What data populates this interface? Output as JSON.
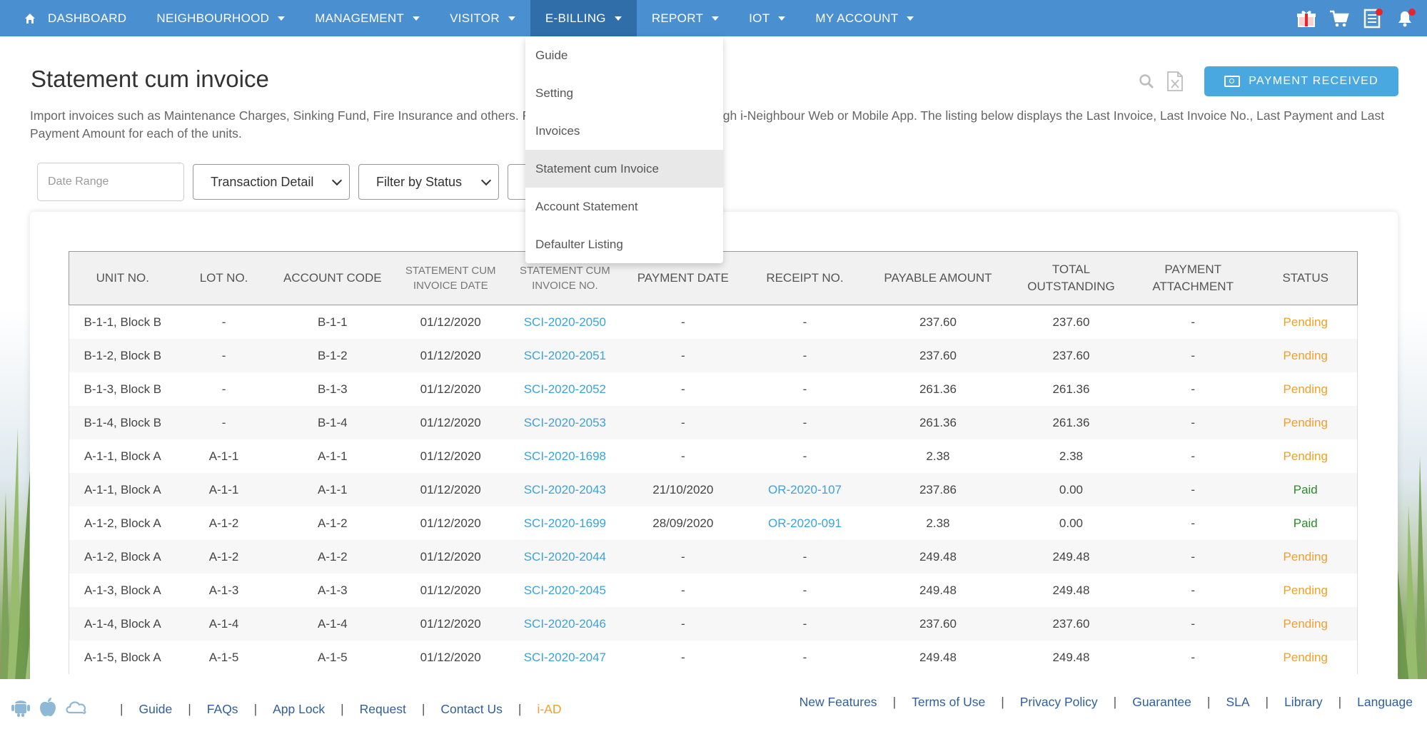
{
  "nav": {
    "items": [
      {
        "label": "DASHBOARD",
        "caret": false
      },
      {
        "label": "NEIGHBOURHOOD",
        "caret": true
      },
      {
        "label": "MANAGEMENT",
        "caret": true
      },
      {
        "label": "VISITOR",
        "caret": true
      },
      {
        "label": "E-BILLING",
        "caret": true,
        "active": true
      },
      {
        "label": "REPORT",
        "caret": true
      },
      {
        "label": "IOT",
        "caret": true
      },
      {
        "label": "MY ACCOUNT",
        "caret": true
      }
    ],
    "right_icons": [
      "gift-icon",
      "cart-icon",
      "notes-icon",
      "bell-icon"
    ]
  },
  "ebilling_menu": {
    "items": [
      {
        "label": "Guide"
      },
      {
        "label": "Setting"
      },
      {
        "label": "Invoices"
      },
      {
        "label": "Statement cum Invoice",
        "selected": true
      },
      {
        "label": "Account Statement"
      },
      {
        "label": "Defaulter Listing"
      }
    ]
  },
  "page": {
    "title": "Statement cum invoice",
    "description": "Import invoices such as Maintenance Charges, Sinking Fund, Fire Insurance and others. Residents will receive invoices through i-Neighbour Web or Mobile App. The listing below displays the Last Invoice, Last Invoice No., Last Payment and Last Payment Amount for each of the units.",
    "payment_button": "PAYMENT RECEIVED"
  },
  "filters": {
    "date_placeholder": "Date Range",
    "transaction": "Transaction Detail",
    "status": "Filter by Status"
  },
  "table": {
    "headers": [
      "UNIT NO.",
      "LOT NO.",
      "ACCOUNT CODE",
      "STATEMENT CUM INVOICE DATE",
      "STATEMENT CUM INVOICE NO.",
      "PAYMENT DATE",
      "RECEIPT NO.",
      "PAYABLE AMOUNT",
      "TOTAL OUTSTANDING",
      "PAYMENT ATTACHMENT",
      "STATUS"
    ],
    "rows": [
      [
        "B-1-1, Block B",
        "-",
        "B-1-1",
        "01/12/2020",
        "SCI-2020-2050",
        "-",
        "-",
        "237.60",
        "237.60",
        "-",
        "Pending"
      ],
      [
        "B-1-2, Block B",
        "-",
        "B-1-2",
        "01/12/2020",
        "SCI-2020-2051",
        "-",
        "-",
        "237.60",
        "237.60",
        "-",
        "Pending"
      ],
      [
        "B-1-3, Block B",
        "-",
        "B-1-3",
        "01/12/2020",
        "SCI-2020-2052",
        "-",
        "-",
        "261.36",
        "261.36",
        "-",
        "Pending"
      ],
      [
        "B-1-4, Block B",
        "-",
        "B-1-4",
        "01/12/2020",
        "SCI-2020-2053",
        "-",
        "-",
        "261.36",
        "261.36",
        "-",
        "Pending"
      ],
      [
        "A-1-1, Block A",
        "A-1-1",
        "A-1-1",
        "01/12/2020",
        "SCI-2020-1698",
        "-",
        "-",
        "2.38",
        "2.38",
        "-",
        "Pending"
      ],
      [
        "A-1-1, Block A",
        "A-1-1",
        "A-1-1",
        "01/12/2020",
        "SCI-2020-2043",
        "21/10/2020",
        "OR-2020-107",
        "237.86",
        "0.00",
        "-",
        "Paid"
      ],
      [
        "A-1-2, Block A",
        "A-1-2",
        "A-1-2",
        "01/12/2020",
        "SCI-2020-1699",
        "28/09/2020",
        "OR-2020-091",
        "2.38",
        "0.00",
        "-",
        "Paid"
      ],
      [
        "A-1-2, Block A",
        "A-1-2",
        "A-1-2",
        "01/12/2020",
        "SCI-2020-2044",
        "-",
        "-",
        "249.48",
        "249.48",
        "-",
        "Pending"
      ],
      [
        "A-1-3, Block A",
        "A-1-3",
        "A-1-3",
        "01/12/2020",
        "SCI-2020-2045",
        "-",
        "-",
        "249.48",
        "249.48",
        "-",
        "Pending"
      ],
      [
        "A-1-4, Block A",
        "A-1-4",
        "A-1-4",
        "01/12/2020",
        "SCI-2020-2046",
        "-",
        "-",
        "237.60",
        "237.60",
        "-",
        "Pending"
      ],
      [
        "A-1-5, Block A",
        "A-1-5",
        "A-1-5",
        "01/12/2020",
        "SCI-2020-2047",
        "-",
        "-",
        "249.48",
        "249.48",
        "-",
        "Pending"
      ]
    ]
  },
  "footer": {
    "left_links": [
      {
        "label": "Guide"
      },
      {
        "label": "FAQs"
      },
      {
        "label": "App Lock"
      },
      {
        "label": "Request"
      },
      {
        "label": "Contact Us"
      },
      {
        "label": "i-AD",
        "accent": true
      }
    ],
    "right_links": [
      {
        "label": "New Features"
      },
      {
        "label": "Terms of Use"
      },
      {
        "label": "Privacy Policy"
      },
      {
        "label": "Guarantee"
      },
      {
        "label": "SLA"
      },
      {
        "label": "Library"
      },
      {
        "label": "Language"
      }
    ],
    "app_icons": [
      "android-icon",
      "apple-icon",
      "cloud-icon"
    ]
  },
  "colors": {
    "nav": "#4a8fcf",
    "nav_active": "#2f6ea8",
    "accent": "#4aa8e0",
    "link": "#3ba3d9",
    "pending": "#f0a02a",
    "paid": "#2d8a2d"
  }
}
